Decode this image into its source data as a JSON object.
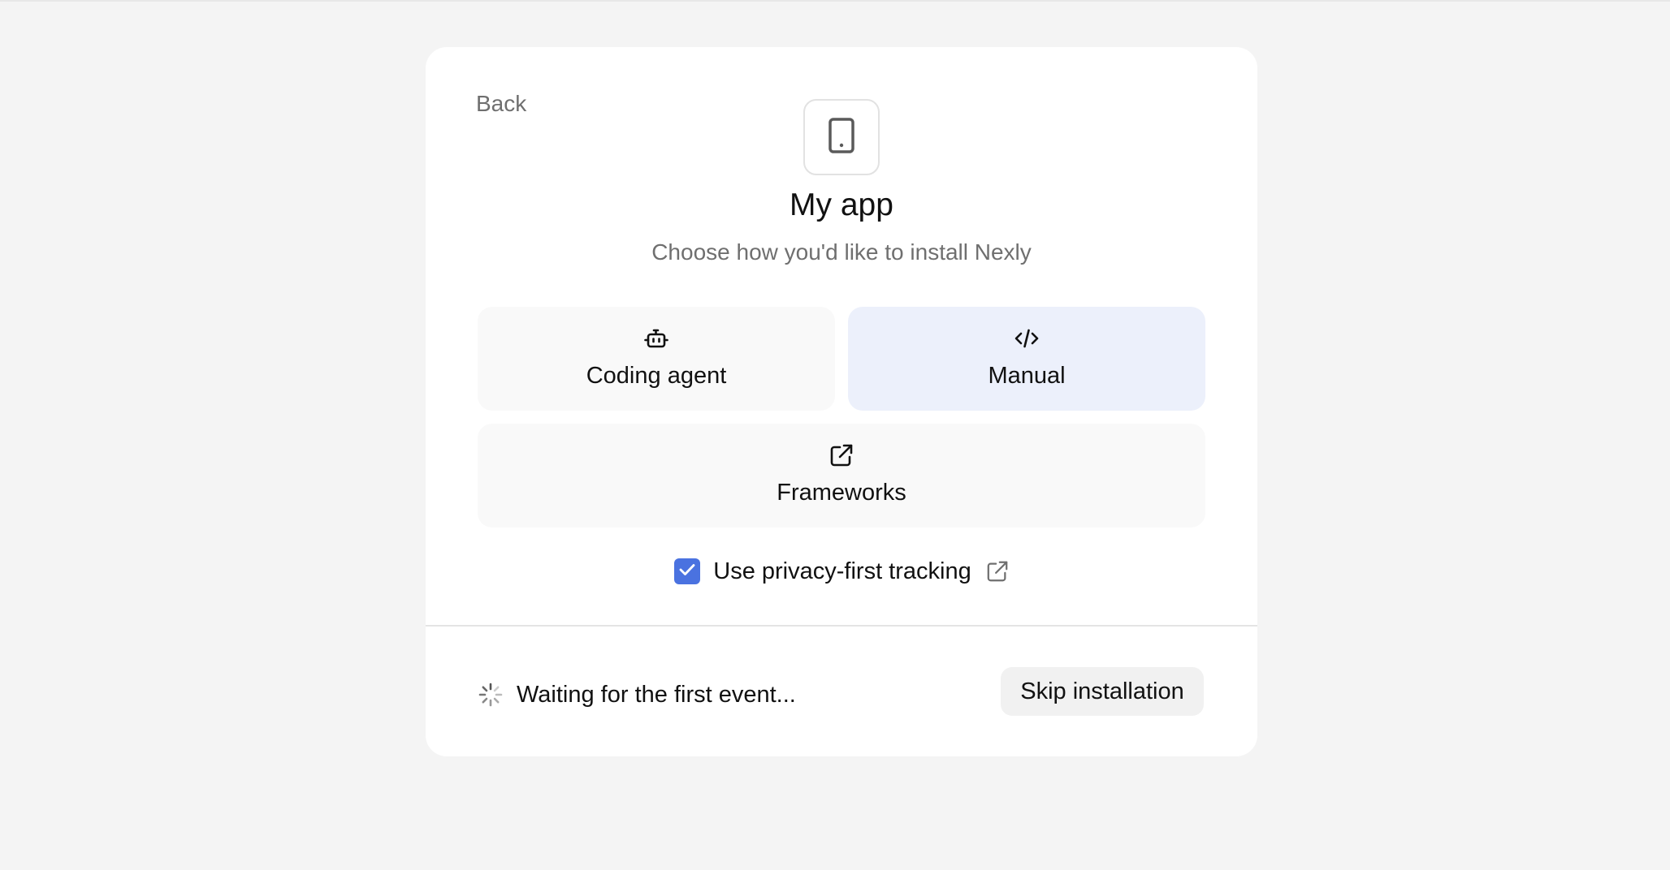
{
  "nav": {
    "back_label": "Back"
  },
  "header": {
    "app_icon": "tablet-icon",
    "title": "My app",
    "subtitle": "Choose how you'd like to install Nexly"
  },
  "options": [
    {
      "icon": "robot-icon",
      "label": "Coding agent",
      "selected": false
    },
    {
      "icon": "code-icon",
      "label": "Manual",
      "selected": true
    },
    {
      "icon": "external-link-icon",
      "label": "Frameworks",
      "selected": false
    }
  ],
  "privacy": {
    "checked": true,
    "label": "Use privacy-first tracking",
    "link_icon": "external-link-icon"
  },
  "footer": {
    "status_icon": "spinner-icon",
    "status_text": "Waiting for the first event...",
    "skip_label": "Skip installation"
  },
  "colors": {
    "accent": "#4a72e0",
    "selected_option_bg": "#ecf0fb",
    "page_bg": "#f4f4f4"
  }
}
